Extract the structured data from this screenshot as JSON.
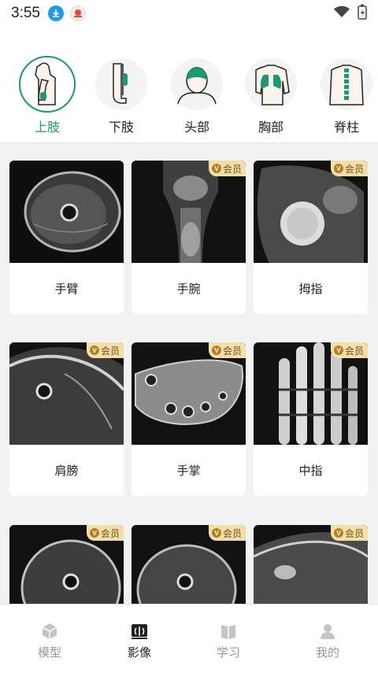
{
  "status_bar": {
    "time": "3:55"
  },
  "categories": [
    {
      "label": "上肢",
      "icon": "upper-limb-icon",
      "active": true
    },
    {
      "label": "下肢",
      "icon": "lower-limb-icon",
      "active": false
    },
    {
      "label": "头部",
      "icon": "head-icon",
      "active": false
    },
    {
      "label": "胸部",
      "icon": "chest-icon",
      "active": false
    },
    {
      "label": "脊柱",
      "icon": "spine-icon",
      "active": false
    }
  ],
  "cards": [
    {
      "title": "手臂",
      "badge": ""
    },
    {
      "title": "手腕",
      "badge": "会员"
    },
    {
      "title": "拇指",
      "badge": "会员"
    },
    {
      "title": "肩膀",
      "badge": "会员"
    },
    {
      "title": "手掌",
      "badge": "会员"
    },
    {
      "title": "中指",
      "badge": "会员"
    },
    {
      "title": "",
      "badge": "会员"
    },
    {
      "title": "",
      "badge": "会员"
    },
    {
      "title": "",
      "badge": "会员"
    }
  ],
  "badge_letter": "V",
  "tabs": [
    {
      "label": "模型",
      "icon": "cube-icon",
      "active": false
    },
    {
      "label": "影像",
      "icon": "xray-icon",
      "active": true
    },
    {
      "label": "学习",
      "icon": "book-icon",
      "active": false
    },
    {
      "label": "我的",
      "icon": "person-icon",
      "active": false
    }
  ],
  "colors": {
    "accent": "#1a9a72",
    "badge_bg": "#f3dfaa",
    "badge_text": "#7a4b17"
  }
}
